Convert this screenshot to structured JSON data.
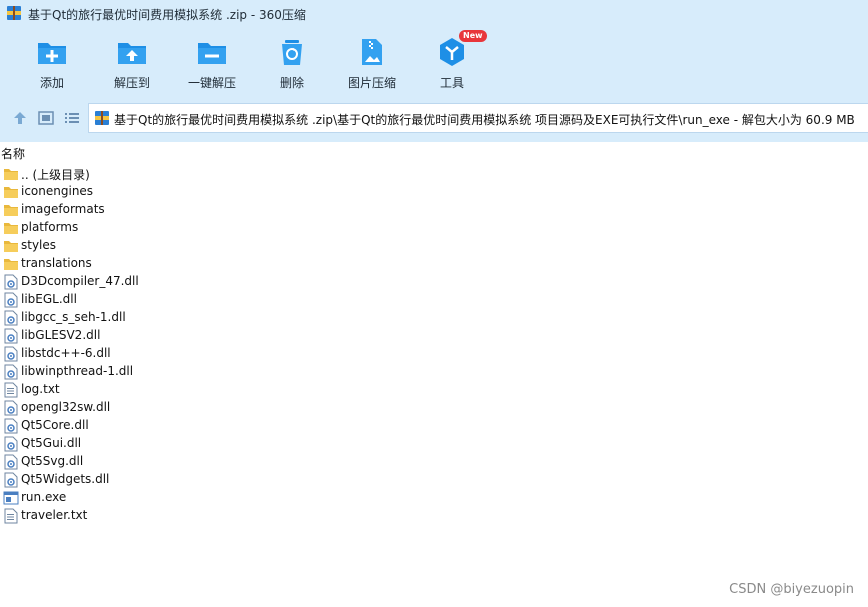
{
  "window": {
    "title": "基于Qt的旅行最优时间费用模拟系统 .zip - 360压缩"
  },
  "toolbar": {
    "items": [
      {
        "label": "添加",
        "icon": "add-icon"
      },
      {
        "label": "解压到",
        "icon": "extract-to-icon"
      },
      {
        "label": "一键解压",
        "icon": "one-click-extract-icon"
      },
      {
        "label": "删除",
        "icon": "delete-icon"
      },
      {
        "label": "图片压缩",
        "icon": "image-compress-icon"
      },
      {
        "label": "工具",
        "icon": "tools-icon",
        "badge": "New"
      }
    ]
  },
  "address": {
    "path": "基于Qt的旅行最优时间费用模拟系统 .zip\\基于Qt的旅行最优时间费用模拟系统 项目源码及EXE可执行文件\\run_exe - 解包大小为 60.9 MB"
  },
  "columns": {
    "name": "名称"
  },
  "files": [
    {
      "name": ".. (上级目录)",
      "type": "folder"
    },
    {
      "name": "iconengines",
      "type": "folder"
    },
    {
      "name": "imageformats",
      "type": "folder"
    },
    {
      "name": "platforms",
      "type": "folder"
    },
    {
      "name": "styles",
      "type": "folder"
    },
    {
      "name": "translations",
      "type": "folder"
    },
    {
      "name": "D3Dcompiler_47.dll",
      "type": "dll"
    },
    {
      "name": "libEGL.dll",
      "type": "dll"
    },
    {
      "name": "libgcc_s_seh-1.dll",
      "type": "dll"
    },
    {
      "name": "libGLESV2.dll",
      "type": "dll"
    },
    {
      "name": "libstdc++-6.dll",
      "type": "dll"
    },
    {
      "name": "libwinpthread-1.dll",
      "type": "dll"
    },
    {
      "name": "log.txt",
      "type": "txt"
    },
    {
      "name": "opengl32sw.dll",
      "type": "dll"
    },
    {
      "name": "Qt5Core.dll",
      "type": "dll"
    },
    {
      "name": "Qt5Gui.dll",
      "type": "dll"
    },
    {
      "name": "Qt5Svg.dll",
      "type": "dll"
    },
    {
      "name": "Qt5Widgets.dll",
      "type": "dll"
    },
    {
      "name": "run.exe",
      "type": "exe"
    },
    {
      "name": "traveler.txt",
      "type": "txt"
    }
  ],
  "watermark": "CSDN @biyezuopin",
  "colors": {
    "toolbar_bg": "#d7ecfb",
    "icon_blue": "#1e8fe6",
    "folder_yellow": "#f6cd5b",
    "badge_red": "#e8363b"
  }
}
